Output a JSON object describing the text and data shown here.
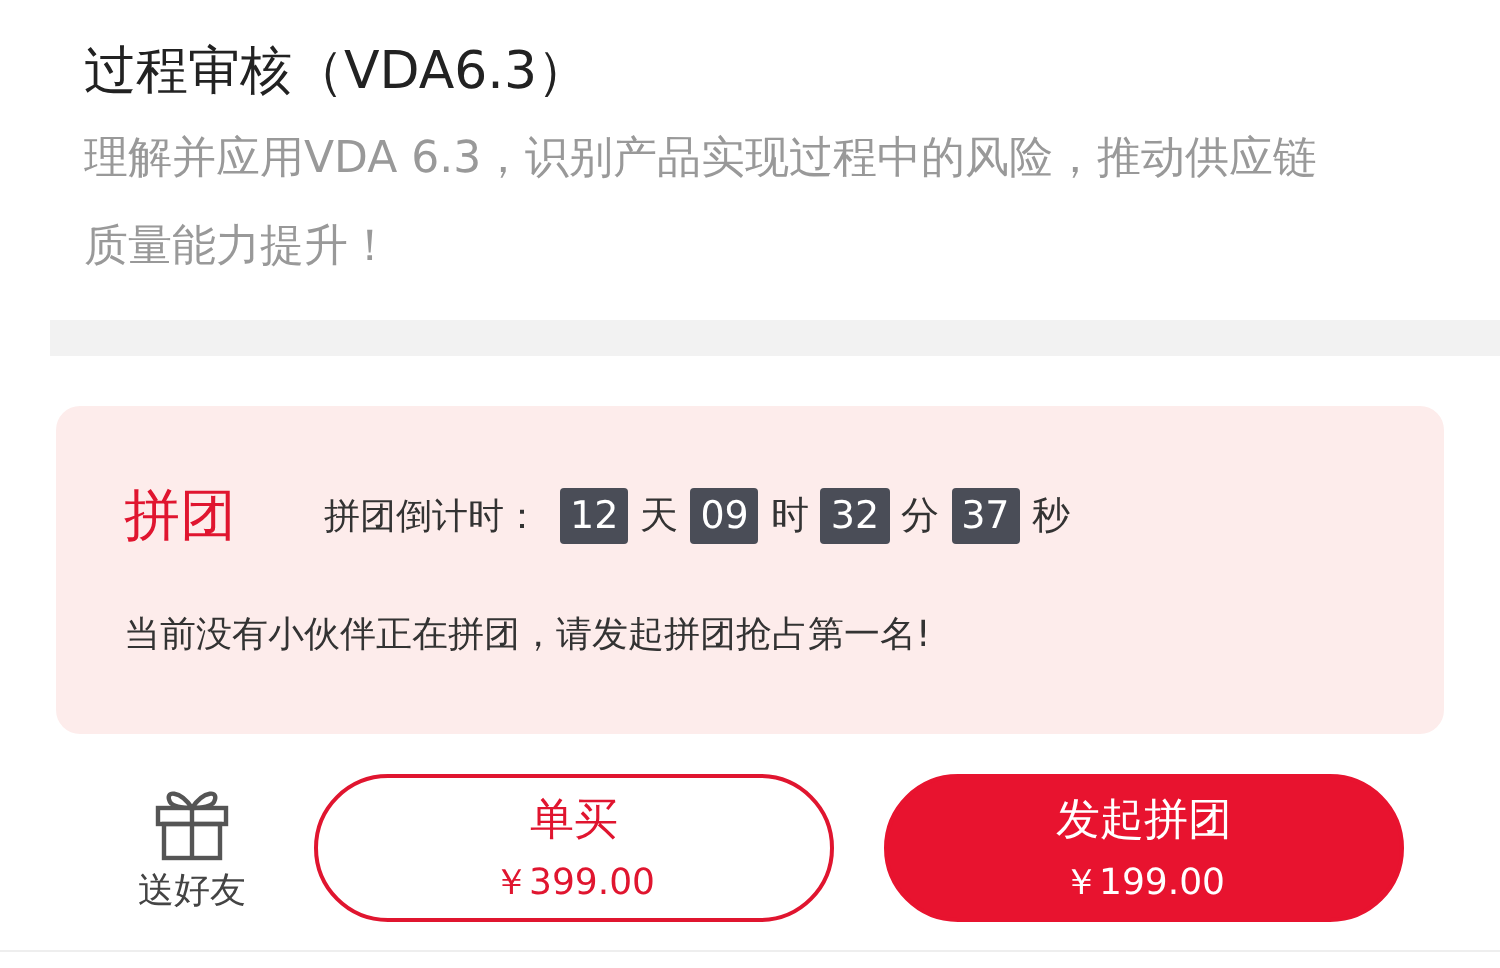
{
  "course": {
    "title": "过程审核（VDA6.3）",
    "description": "理解并应用VDA 6.3，识别产品实现过程中的风险，推动供应链质量能力提升！"
  },
  "group_buy": {
    "label": "拼团",
    "countdown_label": "拼团倒计时：",
    "countdown": [
      {
        "value": "12",
        "unit": "天"
      },
      {
        "value": "09",
        "unit": "时"
      },
      {
        "value": "32",
        "unit": "分"
      },
      {
        "value": "37",
        "unit": "秒"
      }
    ],
    "message": "当前没有小伙伴正在拼团，请发起拼团抢占第一名!"
  },
  "actions": {
    "gift": {
      "label": "送好友"
    },
    "buttons": [
      {
        "kind": "outline",
        "title": "单买",
        "price": "￥399.00"
      },
      {
        "kind": "filled",
        "title": "发起拼团",
        "price": "￥199.00"
      }
    ]
  }
}
